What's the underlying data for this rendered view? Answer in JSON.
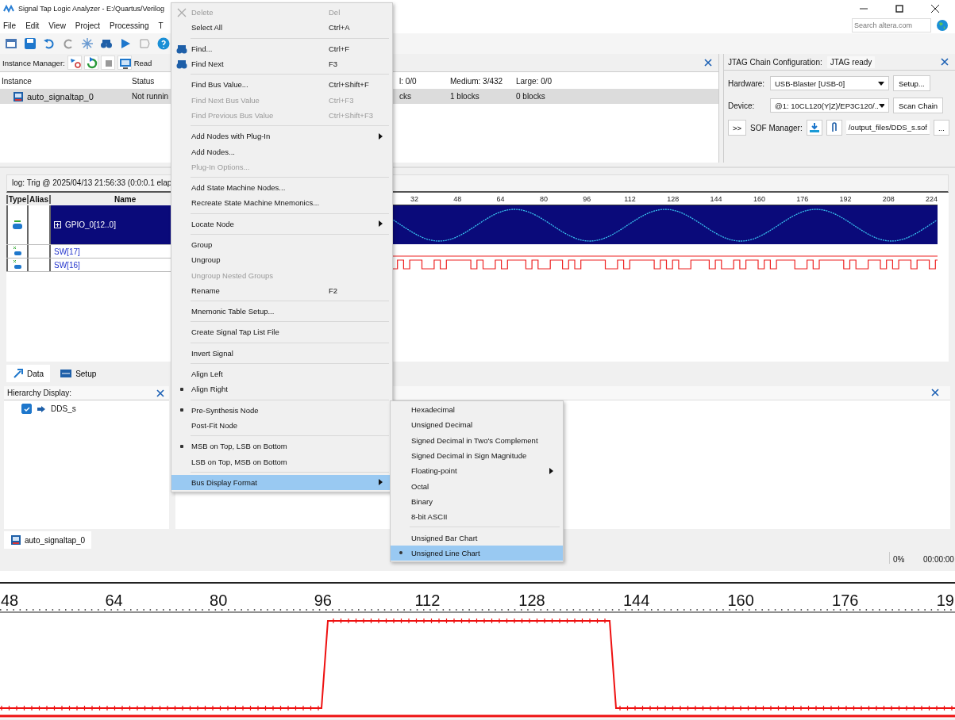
{
  "window": {
    "title": "Signal Tap Logic Analyzer - E:/Quartus/Verilog"
  },
  "menu_bar": [
    "File",
    "Edit",
    "View",
    "Project",
    "Processing",
    "T"
  ],
  "search": {
    "placeholder": "Search altera.com"
  },
  "instance_manager": {
    "label": "Instance Manager:",
    "status_text": "Read",
    "columns": [
      "Instance",
      "Status",
      "l: 0/0",
      "Medium: 3/432",
      "Large: 0/0"
    ],
    "rows": [
      {
        "cells": [
          "auto_signaltap_0",
          "Not runnin",
          "cks",
          "1 blocks",
          "0 blocks"
        ],
        "selected": true
      }
    ]
  },
  "jtag": {
    "title": "JTAG Chain Configuration:",
    "status": "JTAG ready",
    "hardware_label": "Hardware:",
    "hardware": "USB-Blaster [USB-0]",
    "setup_button": "Setup...",
    "device_label": "Device:",
    "device": "@1: 10CL120(Y|Z)/EP3C120/..",
    "scan_button": "Scan Chain",
    "expand_button": ">>",
    "sof_label": "SOF Manager:",
    "sof_file": "/output_files/DDS_s.sof",
    "browse_button": "..."
  },
  "data_view": {
    "log": "log: Trig @ 2025/04/13 21:56:33 (0:0:0.1 elap",
    "columns": [
      "Type",
      "Alias",
      "Name"
    ],
    "nodes": [
      {
        "name": "GPIO_0[12..0]",
        "kind": "bus",
        "selected": true,
        "expanded": false
      },
      {
        "name": "SW[17]",
        "kind": "bit",
        "selected": false
      },
      {
        "name": "SW[16]",
        "kind": "bit",
        "selected": false
      }
    ],
    "ticks": [
      "32",
      "48",
      "64",
      "80",
      "96",
      "112",
      "128",
      "144",
      "160",
      "176",
      "192",
      "208",
      "224"
    ]
  },
  "tabs": [
    {
      "label": "Data",
      "selected": true
    },
    {
      "label": "Setup",
      "selected": false
    }
  ],
  "hierarchy": {
    "title": "Hierarchy Display:",
    "items": [
      {
        "label": "DDS_s",
        "checked": true
      }
    ]
  },
  "instance_tabs": [
    {
      "label": "auto_signaltap_0",
      "selected": true
    }
  ],
  "status_bar": {
    "progress": "0%",
    "time": "00:00:00"
  },
  "context_menu": {
    "groups": [
      [
        {
          "label": "Delete",
          "shortcut": "Del",
          "disabled": true,
          "icon": true,
          "highlighted": false
        },
        {
          "label": "Select All",
          "shortcut": "Ctrl+A",
          "disabled": false,
          "highlighted": false
        }
      ],
      [
        {
          "label": "Find...",
          "shortcut": "Ctrl+F",
          "disabled": false,
          "icon": true,
          "highlighted": false
        },
        {
          "label": "Find Next",
          "shortcut": "F3",
          "disabled": false,
          "icon": true,
          "highlighted": false
        }
      ],
      [
        {
          "label": "Find Bus Value...",
          "shortcut": "Ctrl+Shift+F",
          "disabled": false,
          "highlighted": false
        },
        {
          "label": "Find Next Bus Value",
          "shortcut": "Ctrl+F3",
          "disabled": true,
          "highlighted": false
        },
        {
          "label": "Find Previous Bus Value",
          "shortcut": "Ctrl+Shift+F3",
          "disabled": true,
          "highlighted": false
        }
      ],
      [
        {
          "label": "Add Nodes with Plug-In",
          "submenu": true,
          "disabled": false,
          "highlighted": false
        },
        {
          "label": "Add Nodes...",
          "disabled": false,
          "highlighted": false
        },
        {
          "label": "Plug-In Options...",
          "disabled": true,
          "highlighted": false
        }
      ],
      [
        {
          "label": "Add State Machine Nodes...",
          "disabled": false,
          "highlighted": false
        },
        {
          "label": "Recreate State Machine Mnemonics...",
          "disabled": false,
          "highlighted": false
        }
      ],
      [
        {
          "label": "Locate Node",
          "submenu": true,
          "disabled": false,
          "highlighted": false
        }
      ],
      [
        {
          "label": "Group",
          "disabled": false,
          "highlighted": false
        },
        {
          "label": "Ungroup",
          "disabled": false,
          "highlighted": false
        },
        {
          "label": "Ungroup Nested Groups",
          "disabled": true,
          "highlighted": false
        },
        {
          "label": "Rename",
          "shortcut": "F2",
          "disabled": false,
          "highlighted": false
        }
      ],
      [
        {
          "label": "Mnemonic Table Setup...",
          "disabled": false,
          "highlighted": false
        }
      ],
      [
        {
          "label": "Create Signal Tap List File",
          "disabled": false,
          "highlighted": false
        }
      ],
      [
        {
          "label": "Invert Signal",
          "disabled": false,
          "highlighted": false
        }
      ],
      [
        {
          "label": "Align Left",
          "selected": false,
          "disabled": false,
          "highlighted": false
        },
        {
          "label": "Align Right",
          "selected": true,
          "disabled": false,
          "highlighted": false
        }
      ],
      [
        {
          "label": "Pre-Synthesis Node",
          "selected": true,
          "disabled": false,
          "highlighted": false
        },
        {
          "label": "Post-Fit Node",
          "selected": false,
          "disabled": false,
          "highlighted": false
        }
      ],
      [
        {
          "label": "MSB on Top, LSB on Bottom",
          "selected": true,
          "disabled": false,
          "highlighted": false
        },
        {
          "label": "LSB on Top, MSB on Bottom",
          "selected": false,
          "disabled": false,
          "highlighted": false
        }
      ],
      [
        {
          "label": "Bus Display Format",
          "submenu": true,
          "disabled": false,
          "highlighted": true
        }
      ]
    ]
  },
  "submenu": {
    "groups": [
      [
        {
          "label": "Hexadecimal",
          "selected": false,
          "highlighted": false
        },
        {
          "label": "Unsigned Decimal",
          "selected": false,
          "highlighted": false
        },
        {
          "label": "Signed Decimal in Two's Complement",
          "selected": false,
          "highlighted": false
        },
        {
          "label": "Signed Decimal in Sign Magnitude",
          "selected": false,
          "highlighted": false
        },
        {
          "label": "Floating-point",
          "submenu": true,
          "selected": false,
          "highlighted": false
        },
        {
          "label": "Octal",
          "selected": false,
          "highlighted": false
        },
        {
          "label": "Binary",
          "selected": false,
          "highlighted": false
        },
        {
          "label": "8-bit ASCII",
          "selected": false,
          "highlighted": false
        }
      ],
      [
        {
          "label": "Unsigned Bar Chart",
          "selected": false,
          "highlighted": false
        },
        {
          "label": "Unsigned Line Chart",
          "selected": true,
          "highlighted": true
        }
      ]
    ]
  },
  "zoomed_waveform": {
    "ticks": [
      "48",
      "64",
      "80",
      "96",
      "112",
      "128",
      "144",
      "160",
      "176",
      "19"
    ]
  }
}
